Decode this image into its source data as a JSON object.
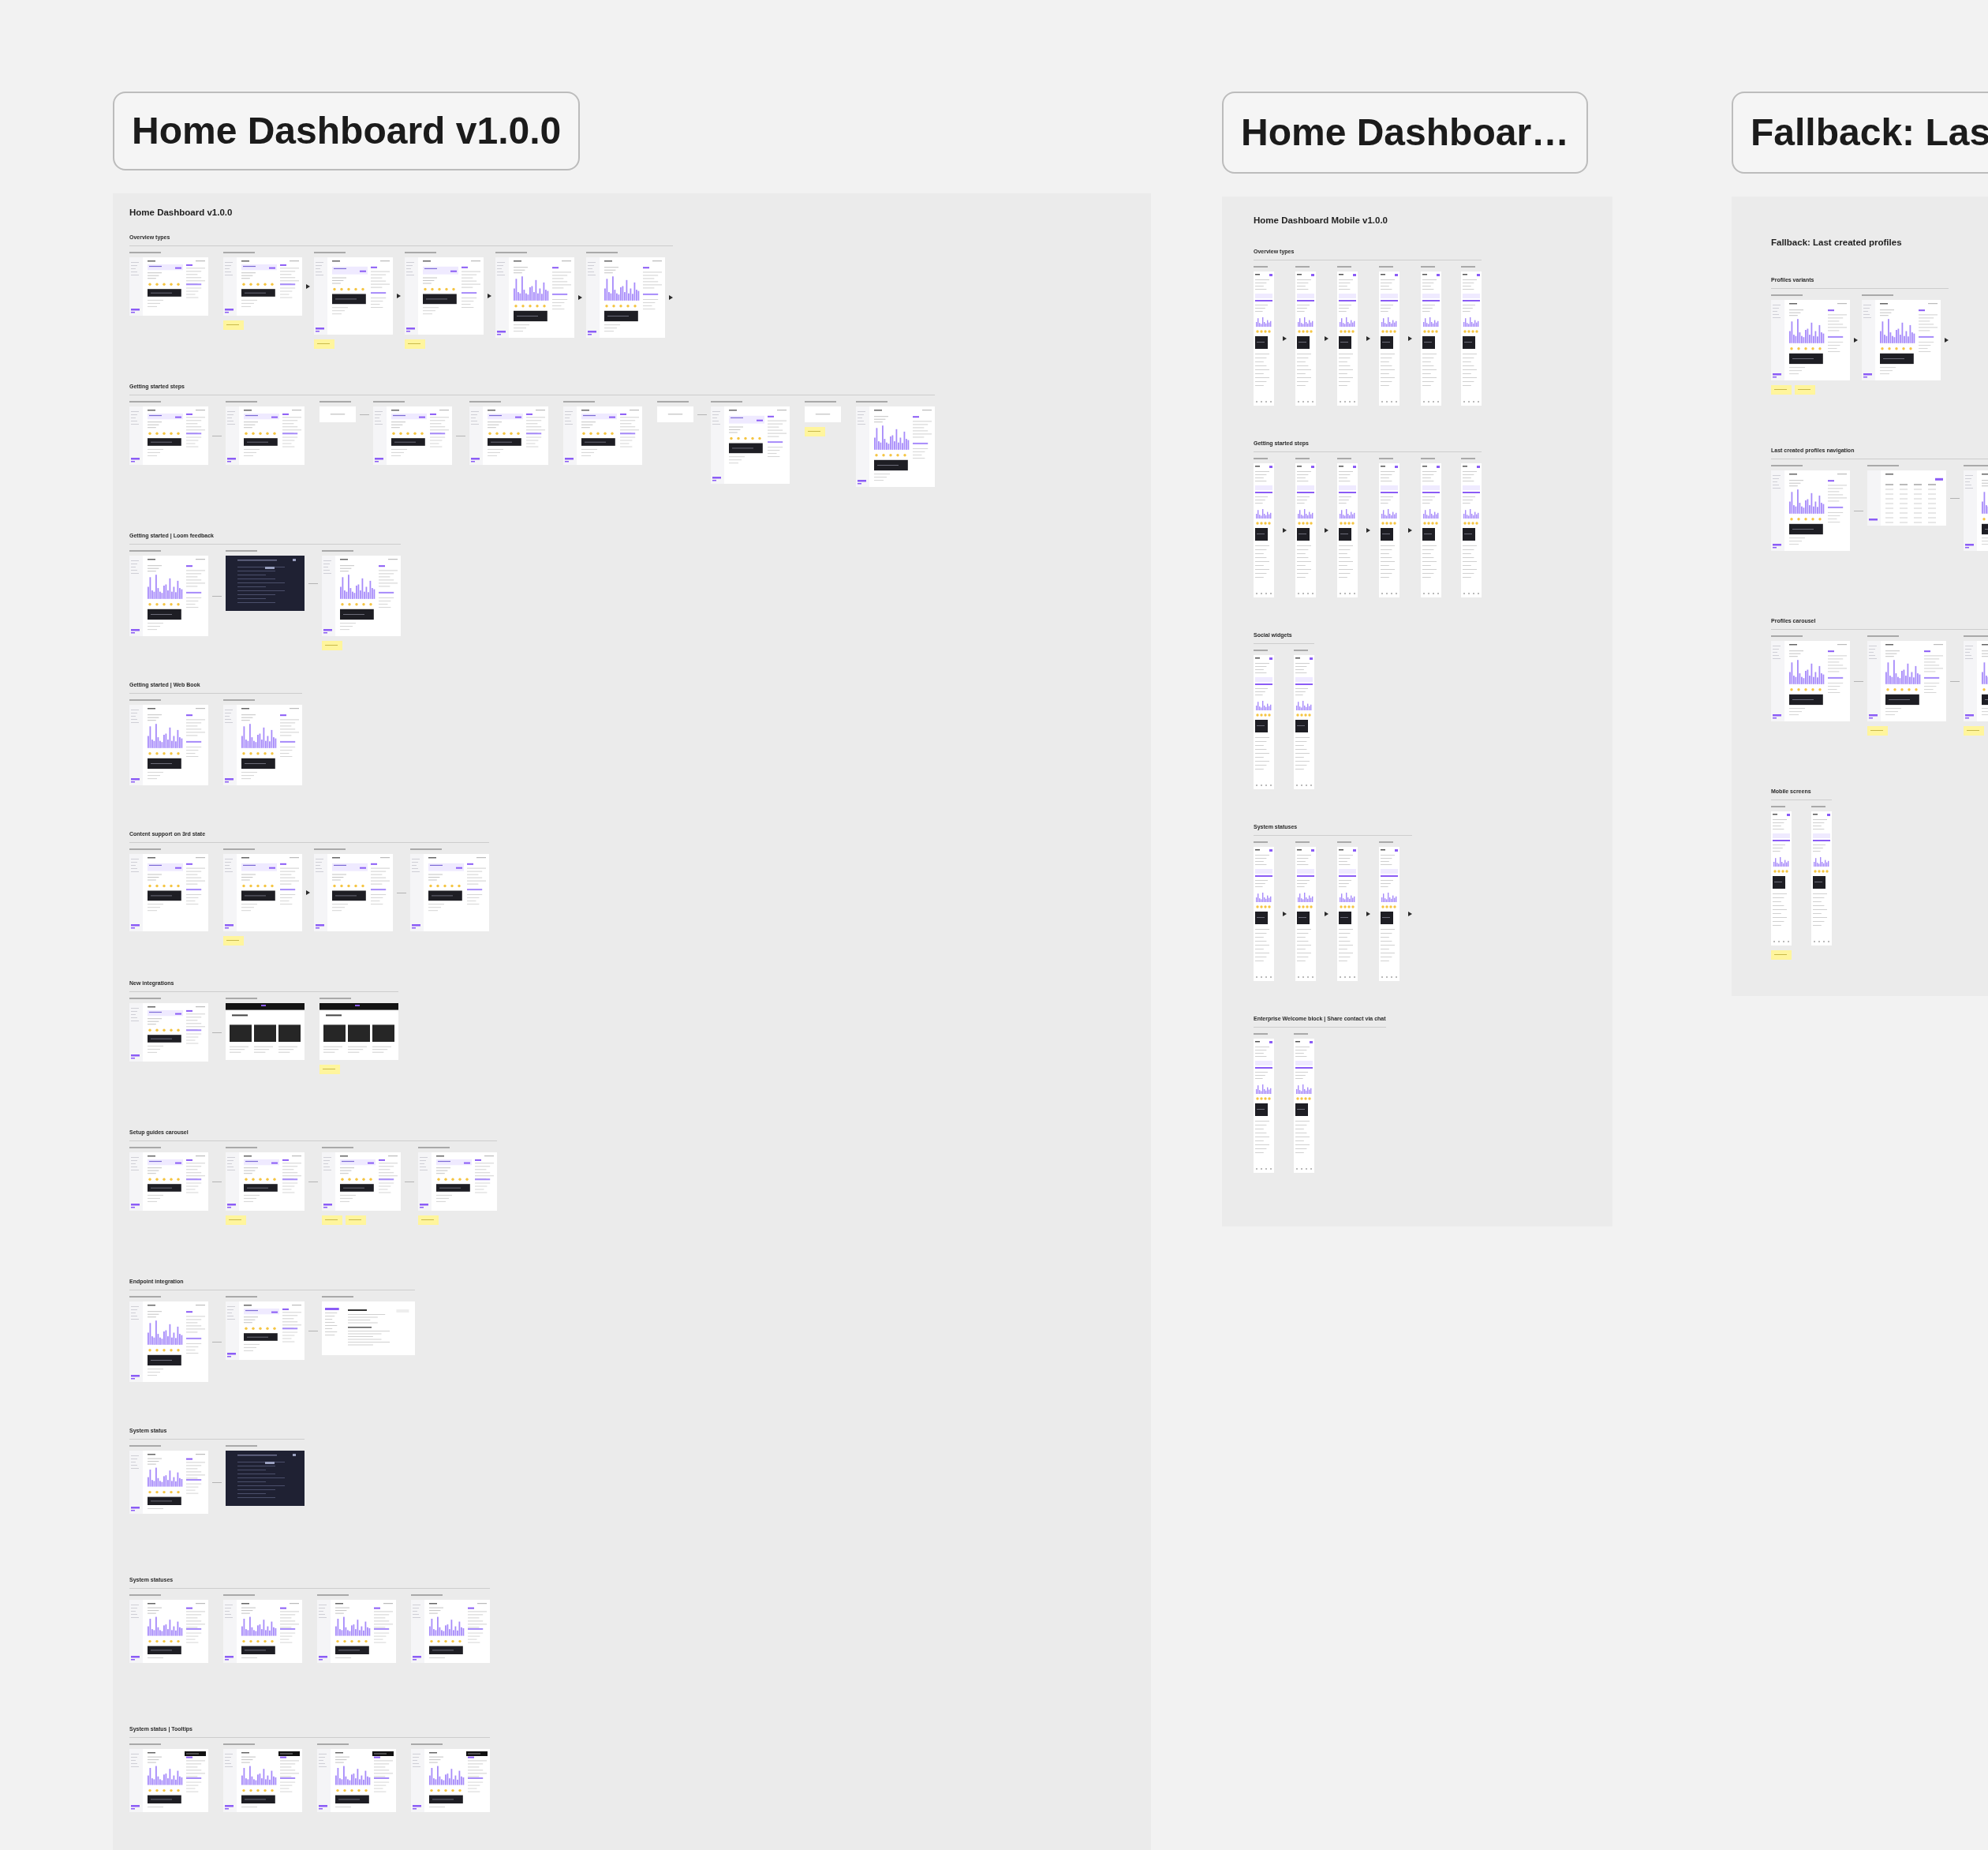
{
  "boards": [
    {
      "label": "Home Dashboard v1.0.0",
      "title": "Home Dashboard v1.0.0",
      "sections": [
        {
          "heading": "Overview types",
          "items": [
            {
              "kind": "plain",
              "note": false
            },
            {
              "kind": "plain",
              "note": true
            },
            {
              "kind": "arrow"
            },
            {
              "kind": "plaintall",
              "note": true
            },
            {
              "kind": "arrow"
            },
            {
              "kind": "plaintall",
              "note": true
            },
            {
              "kind": "arrow"
            },
            {
              "kind": "chart",
              "note": false
            },
            {
              "kind": "arrow"
            },
            {
              "kind": "chart",
              "note": false
            },
            {
              "kind": "arrow"
            }
          ]
        },
        {
          "heading": "Getting started steps",
          "items": [
            {
              "kind": "plain",
              "note": false
            },
            {
              "kind": "line"
            },
            {
              "kind": "plain",
              "note": false
            },
            {
              "kind": "card",
              "note": false
            },
            {
              "kind": "line"
            },
            {
              "kind": "plain",
              "note": false
            },
            {
              "kind": "line"
            },
            {
              "kind": "plain",
              "note": false
            },
            {
              "kind": "plain",
              "note": false
            },
            {
              "kind": "card",
              "note": false
            },
            {
              "kind": "line"
            },
            {
              "kind": "plaintall",
              "note": false
            },
            {
              "kind": "card",
              "note": true
            },
            {
              "kind": "chart",
              "note": false
            }
          ]
        },
        {
          "heading": "Getting started | Loom feedback",
          "items": [
            {
              "kind": "chart",
              "note": false
            },
            {
              "kind": "line"
            },
            {
              "kind": "dark",
              "note": false
            },
            {
              "kind": "line"
            },
            {
              "kind": "chart",
              "note": true
            }
          ]
        },
        {
          "heading": "Getting started | Web Book",
          "items": [
            {
              "kind": "chart",
              "note": false
            },
            {
              "kind": "chart",
              "note": false
            }
          ]
        },
        {
          "heading": "Content support on 3rd state",
          "items": [
            {
              "kind": "plaintall",
              "note": false
            },
            {
              "kind": "plaintall",
              "note": true
            },
            {
              "kind": "arrow"
            },
            {
              "kind": "plaintall",
              "note": false
            },
            {
              "kind": "line"
            },
            {
              "kind": "plaintall",
              "note": false
            }
          ]
        },
        {
          "heading": "New integrations",
          "items": [
            {
              "kind": "plain",
              "note": false
            },
            {
              "kind": "line"
            },
            {
              "kind": "web",
              "note": false
            },
            {
              "kind": "web",
              "note": true
            }
          ]
        },
        {
          "heading": "Setup guides carousel",
          "items": [
            {
              "kind": "plain",
              "note": false
            },
            {
              "kind": "line"
            },
            {
              "kind": "plain",
              "note": true
            },
            {
              "kind": "line"
            },
            {
              "kind": "plain",
              "note": true,
              "second_note": true
            },
            {
              "kind": "line"
            },
            {
              "kind": "plain",
              "note": true
            }
          ]
        },
        {
          "heading": "Endpoint integration",
          "items": [
            {
              "kind": "chart",
              "note": false
            },
            {
              "kind": "line"
            },
            {
              "kind": "plain",
              "note": false
            },
            {
              "kind": "line"
            },
            {
              "kind": "doc",
              "note": false
            }
          ]
        },
        {
          "heading": "System status",
          "items": [
            {
              "kind": "chartshort",
              "note": false
            },
            {
              "kind": "line"
            },
            {
              "kind": "dark",
              "note": false
            }
          ]
        },
        {
          "heading": "System statuses",
          "items": [
            {
              "kind": "chartshort",
              "note": false
            },
            {
              "kind": "chartshort",
              "note": false
            },
            {
              "kind": "chartshort",
              "note": false
            },
            {
              "kind": "chartshort",
              "note": false
            }
          ]
        },
        {
          "heading": "System status | Tooltips",
          "items": [
            {
              "kind": "tooltip",
              "note": false
            },
            {
              "kind": "tooltip",
              "note": false
            },
            {
              "kind": "tooltip",
              "note": false
            },
            {
              "kind": "tooltip",
              "note": false
            }
          ]
        }
      ]
    },
    {
      "label": "Home Dashboar…",
      "title": "Home Dashboard Mobile v1.0.0",
      "sections": [
        {
          "heading": "Overview types",
          "items": [
            {
              "kind": "mobile",
              "note": false
            },
            {
              "kind": "arrow"
            },
            {
              "kind": "mobile",
              "note": false
            },
            {
              "kind": "arrow"
            },
            {
              "kind": "mobile",
              "note": false
            },
            {
              "kind": "arrow"
            },
            {
              "kind": "mobile",
              "note": false
            },
            {
              "kind": "arrow"
            },
            {
              "kind": "mobile",
              "note": false
            },
            {
              "kind": "mobile",
              "note": false
            }
          ]
        },
        {
          "heading": "Getting started steps",
          "items": [
            {
              "kind": "mobile",
              "note": false
            },
            {
              "kind": "arrow"
            },
            {
              "kind": "mobile",
              "note": false
            },
            {
              "kind": "arrow"
            },
            {
              "kind": "mobile",
              "note": false
            },
            {
              "kind": "arrow"
            },
            {
              "kind": "mobile",
              "note": false
            },
            {
              "kind": "arrow"
            },
            {
              "kind": "mobile",
              "note": false
            },
            {
              "kind": "mobile",
              "note": false
            }
          ]
        },
        {
          "heading": "Social widgets",
          "items": [
            {
              "kind": "mobile",
              "note": false
            },
            {
              "kind": "mobile",
              "note": false
            }
          ]
        },
        {
          "heading": "System statuses",
          "items": [
            {
              "kind": "mobile",
              "note": false
            },
            {
              "kind": "arrow"
            },
            {
              "kind": "mobile",
              "note": false
            },
            {
              "kind": "arrow"
            },
            {
              "kind": "mobile",
              "note": false
            },
            {
              "kind": "arrow"
            },
            {
              "kind": "mobile",
              "note": false
            },
            {
              "kind": "arrow"
            }
          ]
        },
        {
          "heading": "Enterprise Welcome block | Share contact via chat",
          "items": [
            {
              "kind": "mobile",
              "note": false
            },
            {
              "kind": "mobile",
              "note": false
            }
          ]
        }
      ]
    },
    {
      "label": "Fallback: Las",
      "title": "Fallback: Last created profiles",
      "sections": [
        {
          "heading": "Profiles variants",
          "items": [
            {
              "kind": "chart",
              "note": true,
              "second_note": true
            },
            {
              "kind": "arrow"
            },
            {
              "kind": "chart",
              "note": false
            },
            {
              "kind": "arrow"
            }
          ]
        },
        {
          "heading": "Last created profiles navigation",
          "items": [
            {
              "kind": "chart",
              "note": false
            },
            {
              "kind": "line"
            },
            {
              "kind": "table",
              "note": false
            },
            {
              "kind": "line"
            },
            {
              "kind": "chart",
              "note": false
            }
          ]
        },
        {
          "heading": "Profiles carousel",
          "items": [
            {
              "kind": "chart",
              "note": false
            },
            {
              "kind": "line"
            },
            {
              "kind": "chart",
              "note": true
            },
            {
              "kind": "line"
            },
            {
              "kind": "chart",
              "note": true
            }
          ]
        },
        {
          "heading": "Mobile screens",
          "items": [
            {
              "kind": "mobile",
              "note": true
            },
            {
              "kind": "mobile",
              "note": false
            }
          ]
        }
      ]
    }
  ]
}
